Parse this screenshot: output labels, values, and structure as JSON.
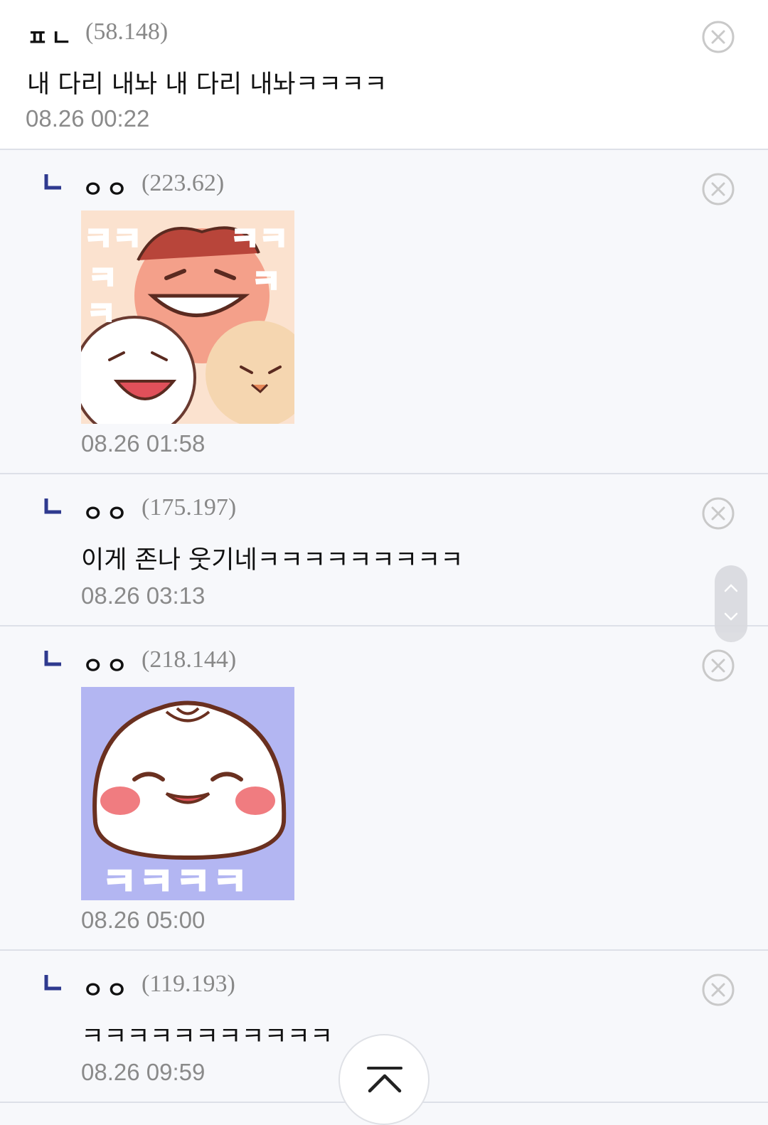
{
  "comments": [
    {
      "nick": "ㅍㄴ",
      "ip": "(58.148)",
      "text": "내 다리 내놔 내 다리 내놔ㅋㅋㅋㅋ",
      "date": "08.26 00:22"
    },
    {
      "nick": "ㅇㅇ",
      "ip": "(223.62)",
      "date": "08.26 01:58",
      "sticker_icon": "laughing-characters-sticker"
    },
    {
      "nick": "ㅇㅇ",
      "ip": "(175.197)",
      "text": "이게 존나 웃기네ㅋㅋㅋㅋㅋㅋㅋㅋㅋ",
      "date": "08.26 03:13"
    },
    {
      "nick": "ㅇㅇ",
      "ip": "(218.144)",
      "date": "08.26 05:00",
      "sticker_icon": "dumpling-laughing-sticker",
      "sticker_text": "ㅋㅋㅋㅋ"
    },
    {
      "nick": "ㅇㅇ",
      "ip": "(119.193)",
      "text": "ㅋㅋㅋㅋㅋㅋㅋㅋㅋㅋㅋ",
      "date": "08.26 09:59"
    }
  ],
  "colors": {
    "reply_mark": "#2f3a8f",
    "divider": "#dde0e8",
    "sticker2_bg": "#b3b6f2",
    "ktext": "#f07c3c"
  }
}
